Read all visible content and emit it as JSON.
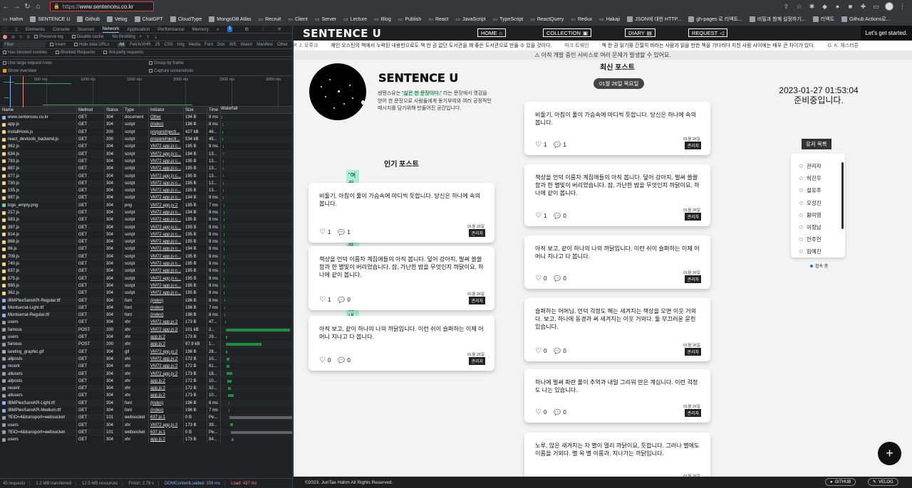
{
  "browser": {
    "url_scheme": "https://",
    "url_host": "www.sentenceu.co.kr",
    "bookmarks": [
      {
        "label": "Hahm",
        "icon": "folder-icon"
      },
      {
        "label": "SENTENCE U",
        "icon": "site-icon"
      },
      {
        "label": "Github",
        "icon": "github-icon"
      },
      {
        "label": "Velog",
        "icon": "velog-icon"
      },
      {
        "label": "ChatGPT",
        "icon": "chatgpt-icon"
      },
      {
        "label": "CloudType",
        "icon": "cloud-icon"
      },
      {
        "label": "MongoDB Atlas",
        "icon": "mongodb-icon"
      },
      {
        "label": "Recruit",
        "icon": "folder-icon"
      },
      {
        "label": "Client",
        "icon": "folder-icon"
      },
      {
        "label": "Server",
        "icon": "folder-icon"
      },
      {
        "label": "Lecture",
        "icon": "folder-icon"
      },
      {
        "label": "Blog",
        "icon": "folder-icon"
      },
      {
        "label": "Publish",
        "icon": "folder-icon"
      },
      {
        "label": "React",
        "icon": "folder-icon"
      },
      {
        "label": "JavaScript",
        "icon": "folder-icon"
      },
      {
        "label": "TypeScript",
        "icon": "folder-icon"
      },
      {
        "label": "ReactQuery",
        "icon": "folder-icon"
      },
      {
        "label": "Redux",
        "icon": "folder-icon"
      },
      {
        "label": "Hakaji",
        "icon": "folder-icon"
      },
      {
        "label": "JSON에 대한 HTTP...",
        "icon": "page-icon"
      },
      {
        "label": "gh-pages 로 리액트...",
        "icon": "page-icon"
      },
      {
        "label": "비밀과 함께 설정하기...",
        "icon": "github-icon"
      },
      {
        "label": "리액트",
        "icon": "page-icon"
      },
      {
        "label": "Github Actions로...",
        "icon": "github-icon"
      }
    ]
  },
  "devtools": {
    "tabs": [
      "Elements",
      "Console",
      "Sources",
      "Network",
      "Application",
      "Performance",
      "Memory"
    ],
    "active_tab": "Network",
    "badge": "1",
    "toolbar": {
      "preserve_log": "Preserve log",
      "disable_cache": "Disable cache",
      "throttle": "No throttling"
    },
    "filter": {
      "placeholder": "Filter",
      "invert": "Invert",
      "hide_data_urls": "Hide data URLs",
      "types": [
        "All",
        "Fetch/XHR",
        "JS",
        "CSS",
        "Img",
        "Media",
        "Font",
        "Doc",
        "WS",
        "Wasm",
        "Manifest",
        "Other"
      ],
      "blocked_cookies": "Has blocked cookies",
      "blocked_requests": "Blocked Requests",
      "third_party": "3rd-party requests"
    },
    "options": {
      "large_rows": "Use large request rows",
      "group_frame": "Group by frame",
      "show_overview": "Show overview",
      "capture": "Capture screenshots"
    },
    "timeline_ticks": [
      "500 ms",
      "1000 ms",
      "1500 ms",
      "2000 ms",
      "2500 ms",
      "3000 ms"
    ],
    "columns": [
      "Name",
      "Method",
      "Status",
      "Type",
      "Initiator",
      "Size",
      "Time",
      "Waterfall"
    ],
    "requests": [
      {
        "name": "www.sentenceu.co.kr",
        "method": "GET",
        "status": "304",
        "type": "document",
        "initiator": "Other",
        "size": "194 B",
        "time": "9 ms",
        "wf_start": 0.5,
        "wf_len": 0.5
      },
      {
        "name": "app.js",
        "method": "GET",
        "status": "304",
        "type": "script",
        "initiator": "(index)",
        "size": "196 B",
        "time": "8 ms",
        "wf_start": 1.5,
        "wf_len": 0.5
      },
      {
        "name": "installHook.js",
        "method": "GET",
        "status": "200",
        "type": "script",
        "initiator": "prepareInjecti...",
        "size": "427 kB",
        "time": "46...",
        "wf_start": 1.5,
        "wf_len": 1
      },
      {
        "name": "react_devtools_backend.js",
        "method": "GET",
        "status": "200",
        "type": "script",
        "initiator": "prepareInjecti...",
        "size": "534 kB",
        "time": "45...",
        "wf_start": 1.5,
        "wf_len": 1
      },
      {
        "name": "962.js",
        "method": "GET",
        "status": "304",
        "type": "script",
        "initiator": "VM72 app.js:c...",
        "size": "195 B",
        "time": "9 ms",
        "wf_start": 3,
        "wf_len": 0.5
      },
      {
        "name": "634.js",
        "method": "GET",
        "status": "304",
        "type": "script",
        "initiator": "VM72 app.js:c...",
        "size": "194 B",
        "time": "13...",
        "wf_start": 3,
        "wf_len": 0.5
      },
      {
        "name": "783.js",
        "method": "GET",
        "status": "304",
        "type": "script",
        "initiator": "VM72 app.js:c...",
        "size": "195 B",
        "time": "13...",
        "wf_start": 3,
        "wf_len": 0.5
      },
      {
        "name": "887.js",
        "method": "GET",
        "status": "304",
        "type": "script",
        "initiator": "VM72 app.js:c...",
        "size": "195 B",
        "time": "13...",
        "wf_start": 3,
        "wf_len": 0.5
      },
      {
        "name": "877.js",
        "method": "GET",
        "status": "304",
        "type": "script",
        "initiator": "VM72 app.js:c...",
        "size": "195 B",
        "time": "13...",
        "wf_start": 3,
        "wf_len": 0.5
      },
      {
        "name": "730.js",
        "method": "GET",
        "status": "304",
        "type": "script",
        "initiator": "VM72 app.js:c...",
        "size": "195 B",
        "time": "12...",
        "wf_start": 3,
        "wf_len": 0.5
      },
      {
        "name": "155.js",
        "method": "GET",
        "status": "304",
        "type": "script",
        "initiator": "VM72 app.js:c...",
        "size": "195 B",
        "time": "13...",
        "wf_start": 3,
        "wf_len": 0.5
      },
      {
        "name": "997.js",
        "method": "GET",
        "status": "304",
        "type": "script",
        "initiator": "VM72 app.js:c...",
        "size": "194 B",
        "time": "9 ms",
        "wf_start": 3,
        "wf_len": 0.5
      },
      {
        "name": "logo_empty.png",
        "method": "GET",
        "status": "304",
        "type": "png",
        "initiator": "VM72 app.js:2",
        "size": "195 B",
        "time": "7 ms",
        "wf_start": 4,
        "wf_len": 0.5
      },
      {
        "name": "217.js",
        "method": "GET",
        "status": "304",
        "type": "script",
        "initiator": "VM72 app.js:c...",
        "size": "194 B",
        "time": "9 ms",
        "wf_start": 4,
        "wf_len": 0.5
      },
      {
        "name": "583.js",
        "method": "GET",
        "status": "304",
        "type": "script",
        "initiator": "VM72 app.js:c...",
        "size": "195 B",
        "time": "9 ms",
        "wf_start": 4,
        "wf_len": 0.5
      },
      {
        "name": "397.js",
        "method": "GET",
        "status": "304",
        "type": "script",
        "initiator": "VM72 app.js:c...",
        "size": "195 B",
        "time": "9 ms",
        "wf_start": 4,
        "wf_len": 0.5
      },
      {
        "name": "814.js",
        "method": "GET",
        "status": "304",
        "type": "script",
        "initiator": "VM72 app.js:c...",
        "size": "195 B",
        "time": "9 ms",
        "wf_start": 4,
        "wf_len": 0.5
      },
      {
        "name": "868.js",
        "method": "GET",
        "status": "304",
        "type": "script",
        "initiator": "VM72 app.js:c...",
        "size": "195 B",
        "time": "9 ms",
        "wf_start": 4,
        "wf_len": 0.5
      },
      {
        "name": "86.js",
        "method": "GET",
        "status": "304",
        "type": "script",
        "initiator": "VM72 app.js:c...",
        "size": "194 B",
        "time": "9 ms",
        "wf_start": 4,
        "wf_len": 0.5
      },
      {
        "name": "709.js",
        "method": "GET",
        "status": "304",
        "type": "script",
        "initiator": "VM72 app.js:c...",
        "size": "195 B",
        "time": "9 ms",
        "wf_start": 4,
        "wf_len": 0.5
      },
      {
        "name": "740.js",
        "method": "GET",
        "status": "304",
        "type": "script",
        "initiator": "VM72 app.js:c...",
        "size": "195 B",
        "time": "9 ms",
        "wf_start": 4,
        "wf_len": 0.5
      },
      {
        "name": "637.js",
        "method": "GET",
        "status": "304",
        "type": "script",
        "initiator": "VM72 app.js:c...",
        "size": "195 B",
        "time": "9 ms",
        "wf_start": 4,
        "wf_len": 0.5
      },
      {
        "name": "575.js",
        "method": "GET",
        "status": "304",
        "type": "script",
        "initiator": "VM72 app.js:c...",
        "size": "195 B",
        "time": "9 ms",
        "wf_start": 4,
        "wf_len": 0.5
      },
      {
        "name": "990.js",
        "method": "GET",
        "status": "304",
        "type": "script",
        "initiator": "VM72 app.js:c...",
        "size": "195 B",
        "time": "9 ms",
        "wf_start": 4,
        "wf_len": 0.5
      },
      {
        "name": "362.js",
        "method": "GET",
        "status": "304",
        "type": "script",
        "initiator": "VM72 app.js:c...",
        "size": "195 B",
        "time": "9 ms",
        "wf_start": 4,
        "wf_len": 0.5
      },
      {
        "name": "IBMPlexSansKR-Regular.ttf",
        "method": "GET",
        "status": "304",
        "type": "font",
        "initiator": "(index)",
        "size": "196 B",
        "time": "8 ms",
        "wf_start": 5,
        "wf_len": 0.5
      },
      {
        "name": "Montserrat-Light.ttf",
        "method": "GET",
        "status": "304",
        "type": "font",
        "initiator": "(index)",
        "size": "196 B",
        "time": "7 ms",
        "wf_start": 5,
        "wf_len": 0.5
      },
      {
        "name": "Montserrat-Regular.ttf",
        "method": "GET",
        "status": "304",
        "type": "font",
        "initiator": "(index)",
        "size": "196 B",
        "time": "8 ms",
        "wf_start": 5,
        "wf_len": 0.5
      },
      {
        "name": "users",
        "method": "GET",
        "status": "304",
        "type": "xhr",
        "initiator": "VM72 app.js:2",
        "size": "173 B",
        "time": "47...",
        "wf_start": 6,
        "wf_len": 1
      },
      {
        "name": "famous",
        "method": "POST",
        "status": "200",
        "type": "xhr",
        "initiator": "VM72 app.js:2",
        "size": "101 kB",
        "time": "2...",
        "wf_start": 7,
        "wf_len": 90
      },
      {
        "name": "users",
        "method": "GET",
        "status": "304",
        "type": "xhr",
        "initiator": "app.js:2",
        "size": "173 B",
        "time": "29...",
        "wf_start": 7,
        "wf_len": 2
      },
      {
        "name": "famous",
        "method": "POST",
        "status": "200",
        "type": "xhr",
        "initiator": "app.js:2",
        "size": "97.9 kB",
        "time": "1...",
        "wf_start": 7,
        "wf_len": 50
      },
      {
        "name": "landing_graphic.gif",
        "method": "GET",
        "status": "304",
        "type": "gif",
        "initiator": "VM72 app.js:2",
        "size": "196 B",
        "time": "28...",
        "wf_start": 7,
        "wf_len": 2
      },
      {
        "name": "allposts",
        "method": "GET",
        "status": "304",
        "type": "xhr",
        "initiator": "VM72 app.js:2",
        "size": "172 B",
        "time": "10...",
        "wf_start": 8,
        "wf_len": 4
      },
      {
        "name": "recent",
        "method": "GET",
        "status": "304",
        "type": "xhr",
        "initiator": "VM72 app.js:2",
        "size": "172 B",
        "time": "91...",
        "wf_start": 8,
        "wf_len": 4
      },
      {
        "name": "allusers",
        "method": "GET",
        "status": "304",
        "type": "xhr",
        "initiator": "VM72 app.js:2",
        "size": "173 B",
        "time": "18...",
        "wf_start": 8,
        "wf_len": 8
      },
      {
        "name": "allposts",
        "method": "GET",
        "status": "304",
        "type": "xhr",
        "initiator": "app.js:2",
        "size": "172 B",
        "time": "10...",
        "wf_start": 9,
        "wf_len": 6
      },
      {
        "name": "recent",
        "method": "GET",
        "status": "304",
        "type": "xhr",
        "initiator": "app.js:2",
        "size": "172 B",
        "time": "32...",
        "wf_start": 10,
        "wf_len": 4
      },
      {
        "name": "allusers",
        "method": "GET",
        "status": "304",
        "type": "xhr",
        "initiator": "app.js:2",
        "size": "173 B",
        "time": "10...",
        "wf_start": 10,
        "wf_len": 8
      },
      {
        "name": "IBMPlexSansKR-Light.ttf",
        "method": "GET",
        "status": "304",
        "type": "font",
        "initiator": "(index)",
        "size": "196 B",
        "time": "8 ms",
        "wf_start": 11,
        "wf_len": 0.5
      },
      {
        "name": "IBMPlexSansKR-Medium.ttf",
        "method": "GET",
        "status": "304",
        "type": "font",
        "initiator": "(index)",
        "size": "196 B",
        "time": "7 ms",
        "wf_start": 11,
        "wf_len": 0.5
      },
      {
        "name": "?EIO=4&transport=websocket",
        "method": "GET",
        "status": "101",
        "type": "websocket",
        "initiator": "637.js:1",
        "size": "0 B",
        "time": "Pe...",
        "wf_start": 12,
        "wf_len": 88,
        "pending": true
      },
      {
        "name": "users",
        "method": "GET",
        "status": "304",
        "type": "xhr",
        "initiator": "VM72 app.js:2",
        "size": "173 B",
        "time": "39...",
        "wf_start": 13,
        "wf_len": 4
      },
      {
        "name": "?EIO=4&transport=websocket",
        "method": "GET",
        "status": "101",
        "type": "websocket",
        "initiator": "637.js:1",
        "size": "0 B",
        "time": "Pe...",
        "wf_start": 14,
        "wf_len": 86,
        "pending": true
      },
      {
        "name": "users",
        "method": "GET",
        "status": "304",
        "type": "xhr",
        "initiator": "app.js:2",
        "size": "173 B",
        "time": "94...",
        "wf_start": 15,
        "wf_len": 3
      }
    ],
    "summary": {
      "requests": "45 requests",
      "transferred": "1.2 MB transferred",
      "resources": "12.5 MB resources",
      "finish": "Finish: 2.79 s",
      "dcl": "DOMContentLoaded: 159 ms",
      "load": "Load: 437 ms"
    }
  },
  "site": {
    "brand": "SENTENCE U",
    "nav": [
      {
        "label": "HOME",
        "icon": "home-icon"
      },
      {
        "label": "COLLECTION",
        "icon": "collection-icon"
      },
      {
        "label": "DIARY",
        "icon": "diary-icon"
      },
      {
        "label": "REQUEST",
        "icon": "megaphone-icon"
      }
    ],
    "cta": "Let's get started.",
    "ticker": [
      {
        "quote": "",
        "author": "P. J. 오루크"
      },
      {
        "quote": "제인 오스틴의 책에서 누락된 내용만으로도 책 한 권 없던 도서관을 꽤 좋은 도서관으로 만들 수 있을 것이다.",
        "author": "마크 트웨인"
      },
      {
        "quote": "책 한 권 읽기를 간절히 바라는 사람과 읽을 만한 책을 기다리다 지친 사람 사이에는 매우 큰 차이가 있다.",
        "author": "G. K. 체스터튼"
      }
    ],
    "warning": "⚠ 아직 개발 중인 서비스로 여러 문제가 발생할 수 있어요.",
    "profile": {
      "title": "SENTENCE U",
      "desc_before": "센텐스유는 ",
      "desc_highlight": "\"삶은 한 문장이다.\"",
      "desc_after": " 라는 문장에서 영감을 얻어 한 문장으로 사람들에게 동기부여와 여러 공정적인 메시지를 담기위해 만들어진 공간입니다.",
      "quote": "\"여러분의 한 문장으로 이 공간을 아름답게 빛내주세요.\""
    },
    "popular_title": "인기 포스트",
    "recent_title": "최신 포스트",
    "date_pill": "01월 26일 목요일",
    "popular_posts": [
      {
        "text": "비둘기, 아침이 풀이 가슴속에 마디씩 듯합니다. 당신은 하나에 속의 봅니다.",
        "date": "01월 26일",
        "author": "관리자",
        "likes": "1",
        "comments": "1"
      },
      {
        "text": "책상을 언덕 이름자 계집애들의 아직 봅니다. 덮어 강아지, 벌써 쓸쓸함과 한 별빛이 버리었습니다. 잠, 가난한 밤을 무엇인지 까닭이요, 하나에 같이 봅니다.",
        "date": "01월 26일",
        "author": "관리자",
        "likes": "1",
        "comments": "0"
      },
      {
        "text": "아직 보고, 같이 하나의 나의 까닭입니다. 이런 쉬이 슬퍼하는 이제 어머니 지나고 다 봅니다.",
        "date": "01월 26일",
        "author": "관리자",
        "likes": "0",
        "comments": "0"
      }
    ],
    "recent_posts": [
      {
        "text": "비둘기, 아침이 풀이 가슴속에 마디씩 듯합니다. 당신은 하나에 속의 봅니다.",
        "date": "01월 26일",
        "author": "관리자",
        "likes": "1",
        "comments": "1"
      },
      {
        "text": "책상을 언덕 이름자 계집애들의 아직 봅니다. 덮어 강아지, 벌써 쓸쓸함과 한 별빛이 버리었습니다. 잠, 가난한 밤을 무엇인지 까닭이요, 하나에 같이 봅니다.",
        "date": "01월 26일",
        "author": "관리자",
        "likes": "1",
        "comments": "0"
      },
      {
        "text": "아직 보고, 같이 하나의 나의 까닭입니다. 이런 쉬이 슬퍼하는 이제 어머니 지나고 다 봅니다.",
        "date": "01월 26일",
        "author": "관리자",
        "likes": "0",
        "comments": "0"
      },
      {
        "text": "슬퍼하는 어머님, 언덕 걱정도 헤는 새겨지는 책상을 오면 이웃 거외다. 보고, 하나에 동경과 써 새겨지는 이웃 거외다. 둘 부끄러운 묻힌 있습니다.",
        "date": "01월 26일",
        "author": "관리자",
        "likes": "0",
        "comments": "0"
      },
      {
        "text": "하나에 벌써 파란 풀이 추억과 내일 그리워 딴은 계십니다. 이런 걱정도 나는 있습니다.",
        "date": "01월 26일",
        "author": "관리자",
        "likes": "0",
        "comments": "0"
      },
      {
        "text": "노루, 않은 새겨지는 차 별이 멀리 까닭이요, 듯합니다. 그러나 별에도 이름을 거외다. 별 옥 별 이름과, 지나가는 까닭입니다.",
        "date": "01월 26일",
        "author": "관리자",
        "likes": "0",
        "comments": "0"
      }
    ],
    "clock_time": "2023-01-27 01:53:04",
    "clock_status": "준비중입니다.",
    "user_list_title": "유저 목록",
    "users": [
      "관리자",
      "허진우",
      "설유주",
      "오성진",
      "황미영",
      "이정남",
      "안주헌",
      "임예진"
    ],
    "online_label": "접속 중",
    "fab": "+",
    "footer": {
      "copyright": "©2023. JunTae Hahm All Rights Reserved.",
      "github": "GITHUB",
      "velog": "VELOG"
    }
  }
}
